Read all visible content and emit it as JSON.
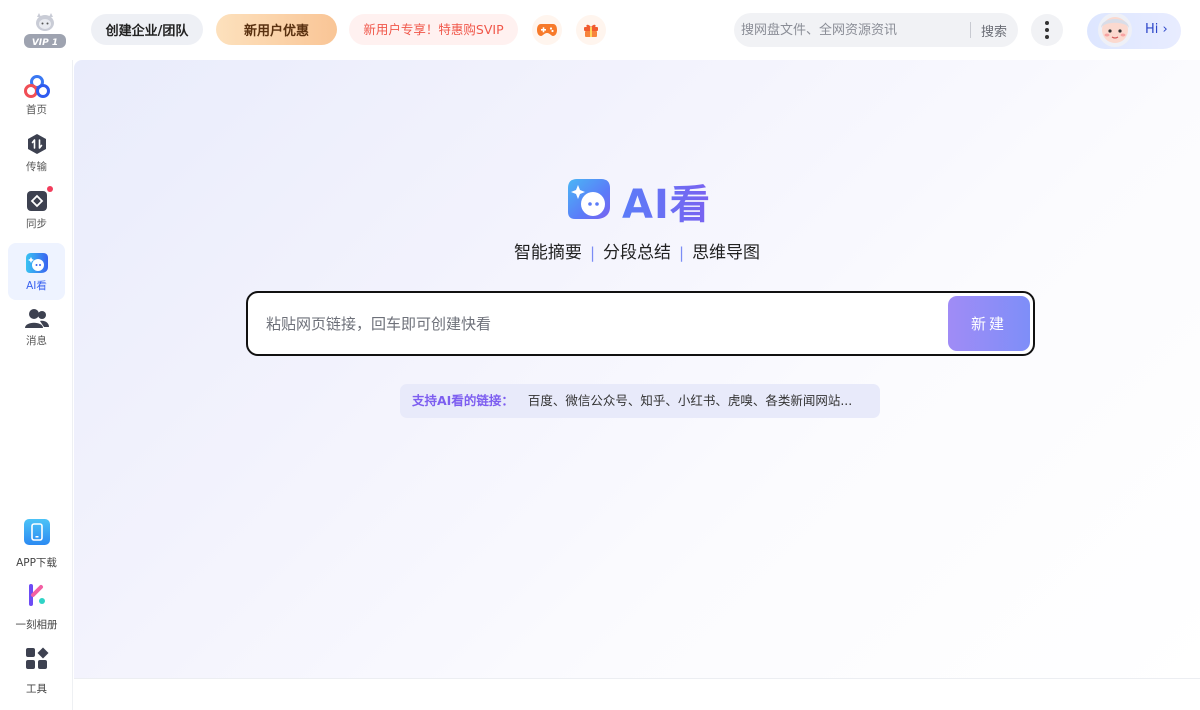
{
  "header": {
    "vip_badge": "VIP 1",
    "team_button": "创建企业/团队",
    "new_user_button": "新用户优惠",
    "svip_promo": "新用户专享！特惠购SVIP",
    "search_placeholder": "搜网盘文件、全网资源资讯",
    "search_button": "搜索",
    "user_greeting": "Hi ›"
  },
  "sidebar": {
    "items": [
      {
        "label": "首页"
      },
      {
        "label": "传输"
      },
      {
        "label": "同步"
      },
      {
        "label": "AI看"
      },
      {
        "label": "消息"
      }
    ],
    "bottom": [
      {
        "label": "APP下载"
      },
      {
        "label": "一刻相册"
      },
      {
        "label": "工具"
      }
    ]
  },
  "main": {
    "logo_title": "AI看",
    "tagline": [
      "智能摘要",
      "分段总结",
      "思维导图"
    ],
    "link_placeholder": "粘贴网页链接，回车即可创建快看",
    "create_button": "新建",
    "support_label": "支持AI看的链接：",
    "support_text": "百度、微信公众号、知乎、小红书、虎嗅、各类新闻网站..."
  },
  "colors": {
    "accent": "#3a63f0",
    "ai_gradient_start": "#5b7cf8",
    "ai_gradient_end": "#7a62f0",
    "promo_red": "#f0574a",
    "notification_dot": "#f23d5c"
  }
}
